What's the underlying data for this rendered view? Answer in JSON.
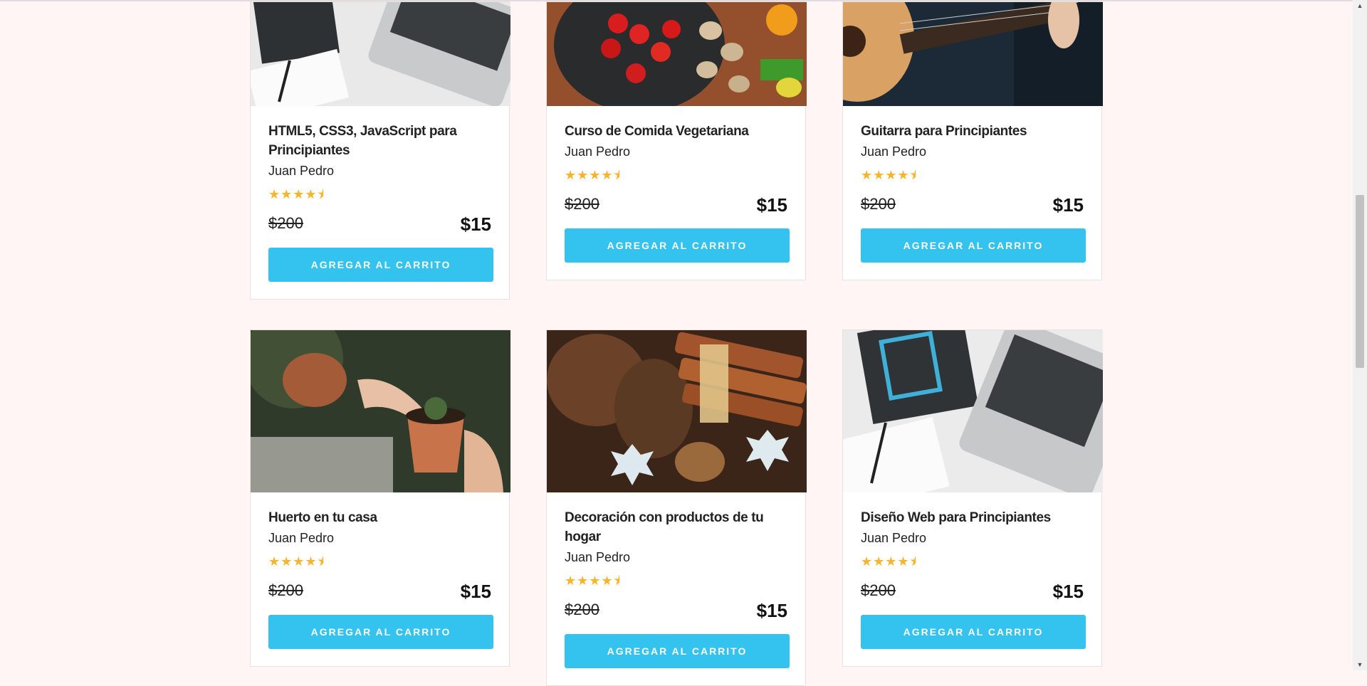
{
  "courses": [
    {
      "title": "HTML5, CSS3, JavaScript para Principiantes",
      "author": "Juan Pedro",
      "stars": "★★★★⯨",
      "old_price": "$200",
      "price": "$15",
      "button": "Agregar al carrito"
    },
    {
      "title": "Curso de Comida Vegetariana",
      "author": "Juan Pedro",
      "stars": "★★★★⯨",
      "old_price": "$200",
      "price": "$15",
      "button": "Agregar al carrito"
    },
    {
      "title": "Guitarra para Principiantes",
      "author": "Juan Pedro",
      "stars": "★★★★⯨",
      "old_price": "$200",
      "price": "$15",
      "button": "Agregar al carrito"
    },
    {
      "title": "Huerto en tu casa",
      "author": "Juan Pedro",
      "stars": "★★★★⯨",
      "old_price": "$200",
      "price": "$15",
      "button": "Agregar al carrito"
    },
    {
      "title": "Decoración con productos de tu hogar",
      "author": "Juan Pedro",
      "stars": "★★★★⯨",
      "old_price": "$200",
      "price": "$15",
      "button": "Agregar al carrito"
    },
    {
      "title": "Diseño Web para Principiantes",
      "author": "Juan Pedro",
      "stars": "★★★★⯨",
      "old_price": "$200",
      "price": "$15",
      "button": "Agregar al carrito"
    }
  ],
  "rating": 4.5,
  "colors": {
    "background": "#fff5f4",
    "button": "#33c3ee",
    "star": "#f7b42c"
  },
  "scrollbar": {
    "up_icon": "chevron-up-icon",
    "down_icon": "chevron-down-icon"
  }
}
